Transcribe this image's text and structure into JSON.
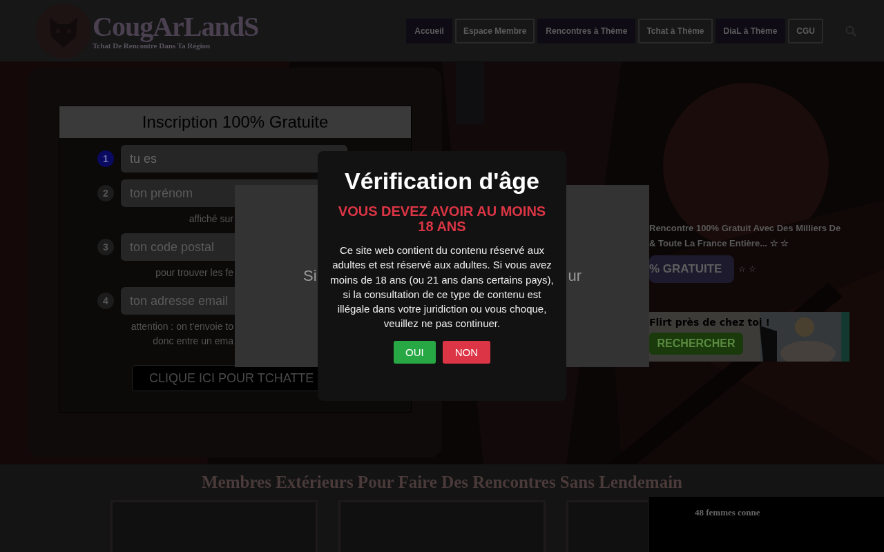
{
  "header": {
    "logo": {
      "title": "CougArLandS",
      "tagline": "Tchat De Rencontre Dans Ta Région"
    },
    "nav": [
      {
        "label": "Accueil",
        "kind": "filled"
      },
      {
        "label": "Espace Membre",
        "kind": "outlined"
      },
      {
        "label": "Rencontres à Thème",
        "kind": "filled"
      },
      {
        "label": "Tchat à Thème",
        "kind": "outlined"
      },
      {
        "label": "DiaL à Thème",
        "kind": "filled"
      },
      {
        "label": "CGU",
        "kind": "outlined"
      }
    ]
  },
  "signup": {
    "title": "Inscription 100% Gratuite",
    "steps": [
      {
        "number": "1",
        "selected": true,
        "kind": "select",
        "value": "tu es"
      },
      {
        "number": "2",
        "selected": false,
        "kind": "input",
        "placeholder": "ton prénom",
        "hint": [
          "affiché sur"
        ]
      },
      {
        "number": "3",
        "selected": false,
        "kind": "input",
        "placeholder": "ton code postal",
        "hint": [
          "pour trouver les fe"
        ]
      },
      {
        "number": "4",
        "selected": false,
        "kind": "input",
        "placeholder": "ton adresse email",
        "hint": [
          "attention : on t'envoie to",
          "donc entre un ema"
        ]
      }
    ],
    "submit": "CLIQUE ICI POUR TCHATTE"
  },
  "promo": {
    "lines": [
      "Rencontre 100% Gratuit Avec Des Milliers De",
      "& Toute La France Entière... ☆ ☆"
    ],
    "button": "% GRATUITE",
    "stars": "☆ ☆",
    "banner": {
      "headline": "Flirt près de chez toi !",
      "button": "RECHERCHER"
    }
  },
  "members": {
    "title": "Membres Extérieurs Pour Faire Des Rencontres Sans Lendemain",
    "online": "48 femmes conne"
  },
  "back_panel": {
    "texts": [
      "Si",
      "ur"
    ]
  },
  "age_modal": {
    "title": "Vérification d'âge",
    "warning": "VOUS DEVEZ AVOIR AU MOINS 18 ANS",
    "message": "Ce site web contient du contenu réservé aux adultes et est réservé aux adultes. Si vous avez moins de 18 ans (ou 21 ans dans certains pays), si la consultation de ce type de contenu est illégale dans votre juridiction ou vous choque, veuillez ne pas continuer.",
    "buttons": [
      {
        "label": "OUI",
        "kind": "accept"
      },
      {
        "label": "NON",
        "kind": "refuse"
      }
    ]
  }
}
